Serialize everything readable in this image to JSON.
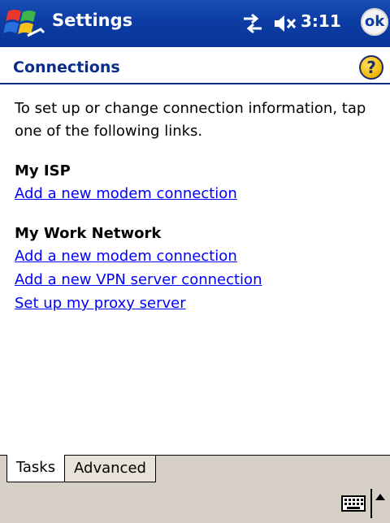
{
  "titlebar": {
    "app_title": "Settings",
    "clock": "3:11",
    "ok_label": "ok",
    "icons": [
      "windows-start-icon",
      "connectivity-icon",
      "volume-muted-icon"
    ]
  },
  "header": {
    "title": "Connections",
    "help_glyph": "?"
  },
  "content": {
    "intro": "To set up or change connection information, tap one of the following links.",
    "sections": [
      {
        "title": "My ISP",
        "links": [
          "Add a new modem connection"
        ]
      },
      {
        "title": "My Work Network",
        "links": [
          "Add a new modem connection",
          "Add a new VPN server connection",
          "Set up my proxy server"
        ]
      }
    ]
  },
  "tabs": [
    {
      "label": "Tasks",
      "active": true
    },
    {
      "label": "Advanced",
      "active": false
    }
  ],
  "colors": {
    "titlebar_bg": "#0b3ca3",
    "link": "#0000ff",
    "header_title": "#0a2d8c",
    "menubar_bg": "#d6cfc6"
  }
}
